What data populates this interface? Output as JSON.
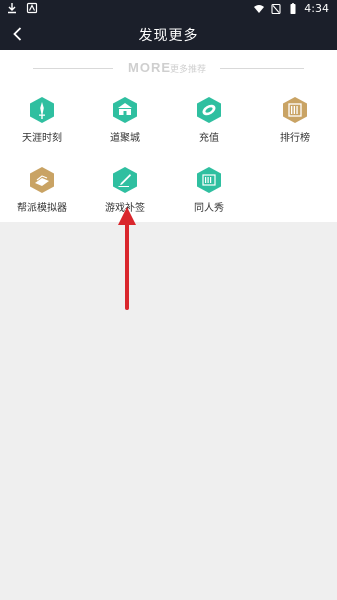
{
  "status_bar": {
    "time": "4:34"
  },
  "header": {
    "title": "发现更多"
  },
  "section": {
    "more": "MORE",
    "subtitle": "更多推荐"
  },
  "items": [
    {
      "label": "天涯时刻",
      "icon": "sword-icon",
      "color": "#2fbfa0"
    },
    {
      "label": "道聚城",
      "icon": "shop-icon",
      "color": "#2fbfa0"
    },
    {
      "label": "充值",
      "icon": "coin-icon",
      "color": "#2fbfa0"
    },
    {
      "label": "排行榜",
      "icon": "ranking-icon",
      "color": "#c9a364"
    },
    {
      "label": "帮派模拟器",
      "icon": "simulator-icon",
      "color": "#c9a364"
    },
    {
      "label": "游戏补签",
      "icon": "brush-icon",
      "color": "#2fbfa0"
    },
    {
      "label": "同人秀",
      "icon": "scroll-icon",
      "color": "#2fbfa0"
    }
  ],
  "colors": {
    "header_bg": "#1b1f2a",
    "teal": "#2fbfa0",
    "gold": "#c9a364",
    "annotation": "#d9262c"
  }
}
